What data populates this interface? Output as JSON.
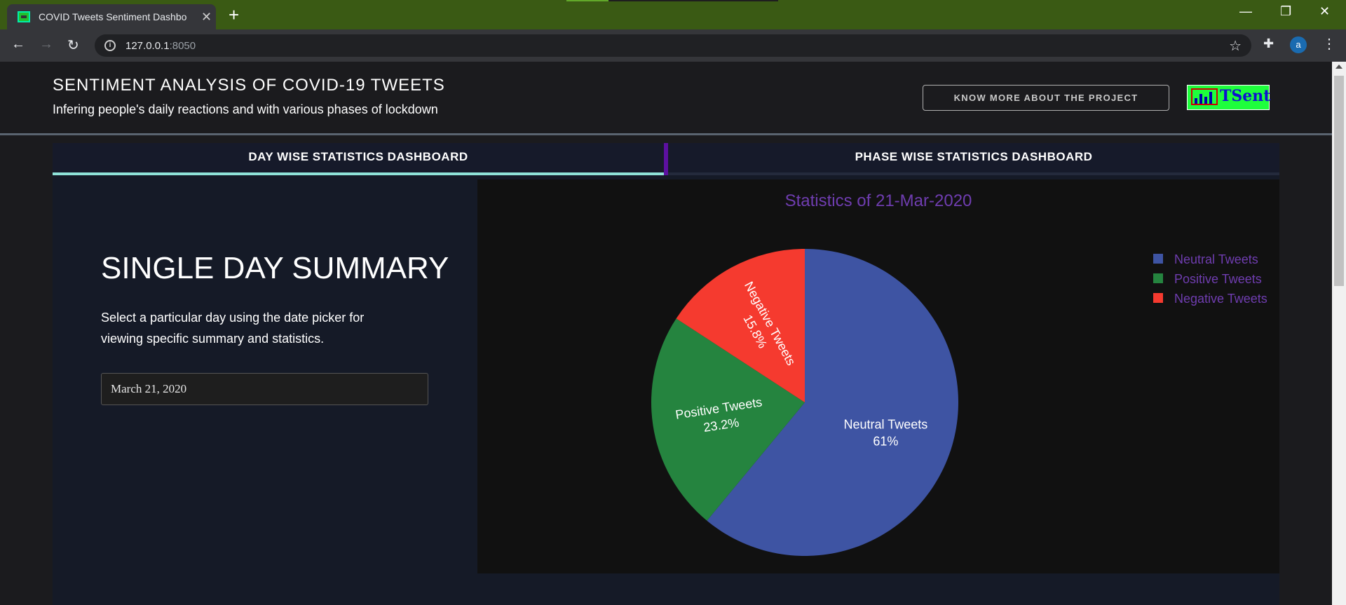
{
  "browser": {
    "tab_title": "COVID Tweets Sentiment Dashbo",
    "url_host": "127.0.0.1",
    "url_port": ":8050",
    "avatar_letter": "a"
  },
  "header": {
    "title": "SENTIMENT ANALYSIS OF COVID-19 TWEETS",
    "subtitle": "Infering people's daily reactions and with various phases of lockdown",
    "know_more_label": "KNOW MORE ABOUT THE PROJECT",
    "logo_text": "TSent"
  },
  "tabs": [
    {
      "label": "DAY WISE STATISTICS DASHBOARD",
      "active": true
    },
    {
      "label": "PHASE WISE STATISTICS DASHBOARD",
      "active": false
    }
  ],
  "summary": {
    "title": "SINGLE DAY SUMMARY",
    "description": "Select a particular day using the date picker for viewing specific summary and statistics.",
    "date_value": "March 21, 2020"
  },
  "chart_data": {
    "type": "pie",
    "title": "Statistics of 21-Mar-2020",
    "labels": [
      "Neutral Tweets",
      "Positive Tweets",
      "Negative Tweets"
    ],
    "values": [
      61,
      23.2,
      15.8
    ],
    "value_labels": [
      "61%",
      "23.2%",
      "15.8%"
    ],
    "colors": [
      "#3e54a3",
      "#25843f",
      "#f53a2f"
    ],
    "legend_text_color": "#6f3db0",
    "legend_position": "top-right"
  }
}
